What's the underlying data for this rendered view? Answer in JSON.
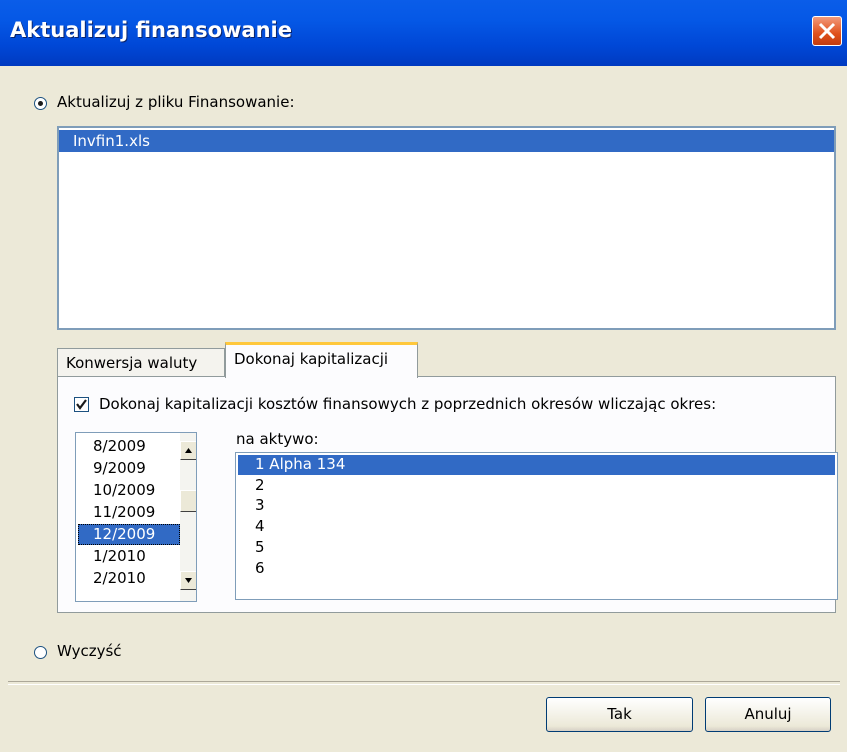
{
  "window": {
    "title": "Aktualizuj finansowanie"
  },
  "option_file": {
    "label": "Aktualizuj z pliku Finansowanie:",
    "selected": true
  },
  "file_list": {
    "items": [
      "Invfin1.xls"
    ],
    "selected_index": 0
  },
  "tabs": [
    {
      "label": "Konwersja waluty",
      "active": false
    },
    {
      "label": "Dokonaj kapitalizacji",
      "active": true
    }
  ],
  "capitalize": {
    "checkbox_label": "Dokonaj kapitalizacji kosztów finansowych z poprzednich okresów wliczając okres:",
    "checked": true,
    "periods": [
      "8/2009",
      "9/2009",
      "10/2009",
      "11/2009",
      "12/2009",
      "1/2010",
      "2/2010"
    ],
    "selected_period": "12/2009",
    "asset_label": "na aktywo:",
    "assets": [
      "1 Alpha 134",
      "2",
      "3",
      "4",
      "5",
      "6"
    ],
    "selected_asset": "1 Alpha 134"
  },
  "option_clear": {
    "label": "Wyczyść",
    "selected": false
  },
  "buttons": {
    "ok": "Tak",
    "cancel": "Anuluj"
  }
}
